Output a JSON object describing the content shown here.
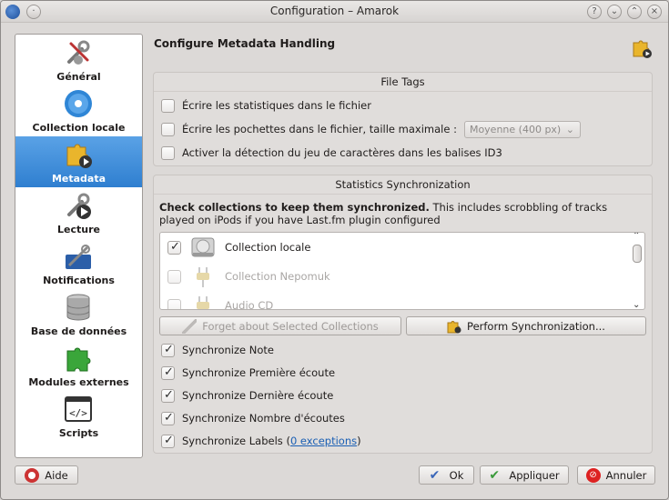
{
  "window": {
    "title": "Configuration – Amarok"
  },
  "sidebar": {
    "items": [
      {
        "label": "Général",
        "icon": "tools-icon"
      },
      {
        "label": "Collection locale",
        "icon": "disc-icon"
      },
      {
        "label": "Metadata",
        "icon": "puzzle-play-icon",
        "active": true
      },
      {
        "label": "Lecture",
        "icon": "playback-icon"
      },
      {
        "label": "Notifications",
        "icon": "notifications-icon"
      },
      {
        "label": "Base de données",
        "icon": "database-icon"
      },
      {
        "label": "Modules externes",
        "icon": "plugin-icon"
      },
      {
        "label": "Scripts",
        "icon": "scripts-icon"
      }
    ]
  },
  "header": {
    "title": "Configure Metadata Handling"
  },
  "file_tags": {
    "title": "File Tags",
    "write_stats": "Écrire les statistiques dans le fichier",
    "write_covers": "Écrire les pochettes dans le fichier, taille maximale :",
    "cover_size": "Moyenne (400 px)",
    "charset_detect": "Activer la détection du jeu de caractères dans les balises ID3"
  },
  "stats_sync": {
    "title": "Statistics Synchronization",
    "desc_bold": "Check collections to keep them synchronized.",
    "desc_rest": " This includes scrobbling of tracks played on iPods if you have Last.fm plugin configured",
    "collections": [
      {
        "label": "Collection locale",
        "checked": true,
        "enabled": true
      },
      {
        "label": "Collection Nepomuk",
        "checked": false,
        "enabled": false
      },
      {
        "label": "Audio CD",
        "checked": false,
        "enabled": false
      }
    ],
    "forget_button": "Forget about Selected Collections",
    "perform_button": "Perform Synchronization...",
    "sync_items": [
      {
        "label": "Synchronize Note",
        "checked": true
      },
      {
        "label": "Synchronize Première écoute",
        "checked": true
      },
      {
        "label": "Synchronize Dernière écoute",
        "checked": true
      },
      {
        "label": "Synchronize Nombre d'écoutes",
        "checked": true
      },
      {
        "label": "Synchronize Labels (",
        "checked": true
      }
    ],
    "exceptions_link": "0 exceptions",
    "labels_close": ")"
  },
  "buttons": {
    "help": "Aide",
    "ok": "Ok",
    "apply": "Appliquer",
    "cancel": "Annuler"
  }
}
